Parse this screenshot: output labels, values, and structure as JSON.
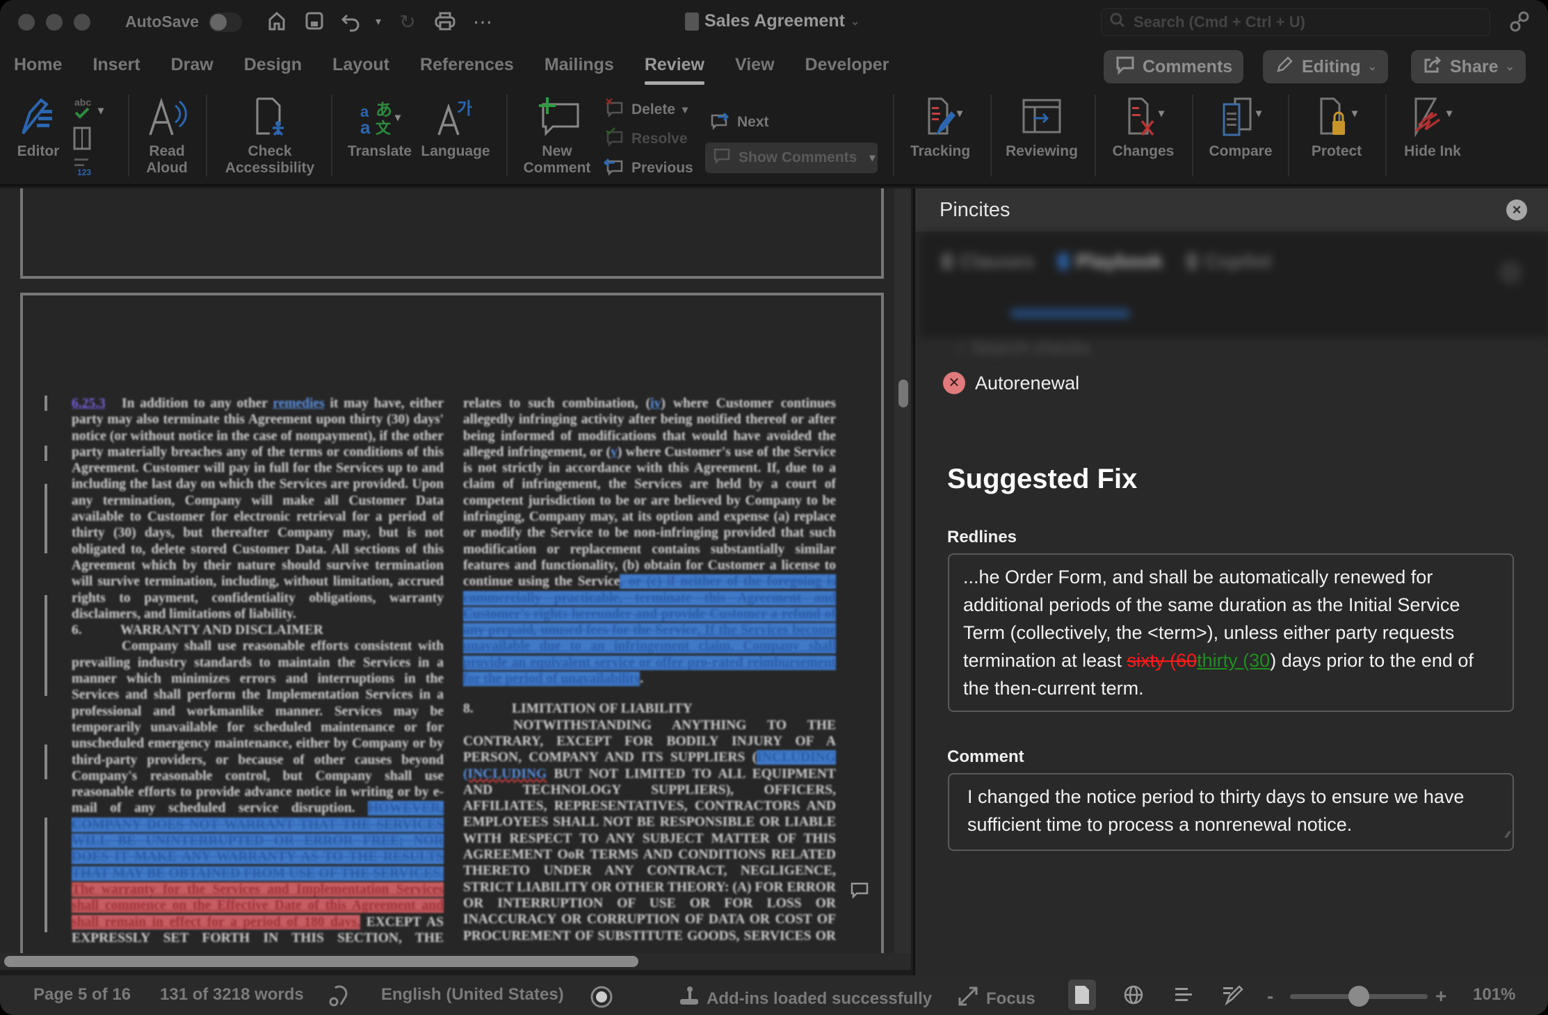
{
  "window": {
    "autosave_label": "AutoSave",
    "doc_title": "Sales Agreement",
    "search_placeholder": "Search (Cmd + Ctrl + U)"
  },
  "tabs": [
    {
      "label": "Home"
    },
    {
      "label": "Insert"
    },
    {
      "label": "Draw"
    },
    {
      "label": "Design"
    },
    {
      "label": "Layout"
    },
    {
      "label": "References"
    },
    {
      "label": "Mailings"
    },
    {
      "label": "Review",
      "active": true
    },
    {
      "label": "View"
    },
    {
      "label": "Developer"
    }
  ],
  "header_buttons": {
    "comments": "Comments",
    "editing": "Editing",
    "share": "Share"
  },
  "ribbon": {
    "editor": "Editor",
    "read_aloud_1": "Read",
    "read_aloud_2": "Aloud",
    "check_1": "Check",
    "check_2": "Accessibility",
    "translate": "Translate",
    "language": "Language",
    "new_comment_1": "New",
    "new_comment_2": "Comment",
    "delete": "Delete",
    "resolve": "Resolve",
    "previous": "Previous",
    "next": "Next",
    "show_comments": "Show Comments",
    "tracking": "Tracking",
    "reviewing": "Reviewing",
    "changes": "Changes",
    "compare": "Compare",
    "protect": "Protect",
    "hide_ink": "Hide Ink"
  },
  "document": {
    "left_col": {
      "p1_num": "6.25.3",
      "p1_a": "In addition to any other ",
      "p1_link": "remedies",
      "p1_b": " it may have, either party may also terminate this Agreement upon thirty (30) days' notice (or without notice in the case of nonpayment), if the other party materially breaches any of the terms or conditions of this Agreement.  Customer will pay in full for the Services up to and including the last day on which the Services are provided. Upon any termination, Company will make all Customer Data available to Customer for electronic retrieval for a period of thirty (30) days, but thereafter Company may, but is not obligated to, delete stored Customer Data.  All sections of this Agreement which by their nature should survive termination will survive termination, including, without limitation, accrued rights to payment, confidentiality obligations, warranty disclaimers, and limitations of liability.",
      "h6_num": "6.",
      "h6": "WARRANTY AND DISCLAIMER",
      "p2": "Company shall use reasonable efforts consistent with prevailing industry standards to maintain the Services in a manner which minimizes errors and interruptions in the Services and shall perform the Implementation Services in a professional and workmanlike manner.  Services may be temporarily unavailable for scheduled maintenance or for unscheduled emergency maintenance, either by Company or by third-party providers, or because of other causes beyond Company's reasonable control, but Company shall use reasonable efforts to provide advance notice in writing or by e-mail of any scheduled service disruption. ",
      "p2_del": "HOWEVER, COMPANY DOES NOT WARRANT THAT THE SERVICES WILL BE UNINTERRUPTED OR ERROR FREE; NOR DOES IT MAKE ANY WARRANTY AS TO THE RESULTS THAT MAY BE OBTAINED FROM USE OF THE SERVICES.",
      "p2_ins": " The warranty for the Services and Implementation Services shall commence on the Effective Date of this Agreement and shall remain in effect for a period of 180 days.",
      "p2_tail": " EXCEPT AS EXPRESSLY SET FORTH IN THIS SECTION, THE SERVICES AND IMPLEMENTATION SERVICES ARE"
    },
    "right_col": {
      "p1": "relates to such combination, (",
      "p1_iv": "iv",
      "p1_b": ") where Customer continues allegedly infringing activity after being notified thereof or after being informed of modifications that would have avoided the alleged infringement, or (",
      "p1_v": "v",
      "p1_c": ") where Customer's use of the Service is not strictly in accordance with this Agreement.  If, due to a claim of infringement, the Services are held by a court of competent jurisdiction to be or are believed by Company to be infringing, Company may, at its option and expense (a) replace or modify the Service to be non-infringing provided that such modification or replacement contains substantially similar features and functionality, (b) obtain for Customer a license to continue using the Service",
      "p1_del": ", or (c) if neither of the foregoing is commercially practicable, terminate this Agreement and Customer's rights hereunder and provide Customer a refund of any prepaid, unused fees for the Service",
      "p1_ins": ". If the Services become unavailable due to an infringement claim, Company shall provide an equivalent service or offer pro-rated reimbursement for the period of unavailability",
      "p1_end": ".",
      "h8_num": "8.",
      "h8": "LIMITATION OF LIABILITY",
      "p2_a": "NOTWITHSTANDING ANYTHING TO THE CONTRARY, EXCEPT FOR BODILY INJURY OF A PERSON, COMPANY AND ITS SUPPLIERS (",
      "p2_inc1": "INCLUDING",
      "p2_inc2": " (INCLUDING",
      "p2_b": " BUT NOT LIMITED TO ALL EQUIPMENT AND TECHNOLOGY SUPPLIERS), OFFICERS, AFFILIATES, REPRESENTATIVES, CONTRACTORS AND EMPLOYEES SHALL NOT BE RESPONSIBLE OR LIABLE WITH RESPECT TO ANY SUBJECT MATTER OF THIS AGREEMENT OoR TERMS AND CONDITIONS RELATED THERETO UNDER ANY CONTRACT, NEGLIGENCE, STRICT LIABILITY OR OTHER THEORY: (A) FOR ERROR OR INTERRUPTION OF USE OR FOR LOSS OR INACCURACY OR CORRUPTION OF DATA OR COST OF PROCUREMENT OF SUBSTITUTE GOODS, SERVICES OR TECHNOLOGY OR LOSS OF BUSINESS; (B) FOR ANY"
    }
  },
  "pane": {
    "title": "Pincites",
    "blurred_tabs": [
      "Clauses",
      "Playbook",
      "Copilot"
    ],
    "blurred_search": "Search checks",
    "issue_label": "Autorenewal",
    "suggested_fix_title": "Suggested Fix",
    "redlines_label": "Redlines",
    "redline_before": "...he Order Form, and shall be automatically renewed for additional periods of the same duration as the Initial Service Term (collectively, the <term>), unless either party requests termination at least ",
    "redline_deleted": "sixty (60",
    "redline_inserted": "thirty (30",
    "redline_after": ") days prior to the end of the then-current term.",
    "comment_label": "Comment",
    "comment_text": "I changed the notice period to thirty days to ensure we have sufficient time to process a nonrenewal notice.",
    "colors": {
      "deleted": "#ff1a1a",
      "inserted": "#1f8f1f",
      "error": "#e07a7c"
    }
  },
  "status": {
    "page": "Page 5 of 16",
    "words": "131 of 3218 words",
    "language": "English (United States)",
    "addins": "Add-ins loaded successfully",
    "focus": "Focus",
    "zoom_minus": "-",
    "zoom_plus": "+",
    "zoom_level": "101%",
    "zoom_percent": 101
  }
}
